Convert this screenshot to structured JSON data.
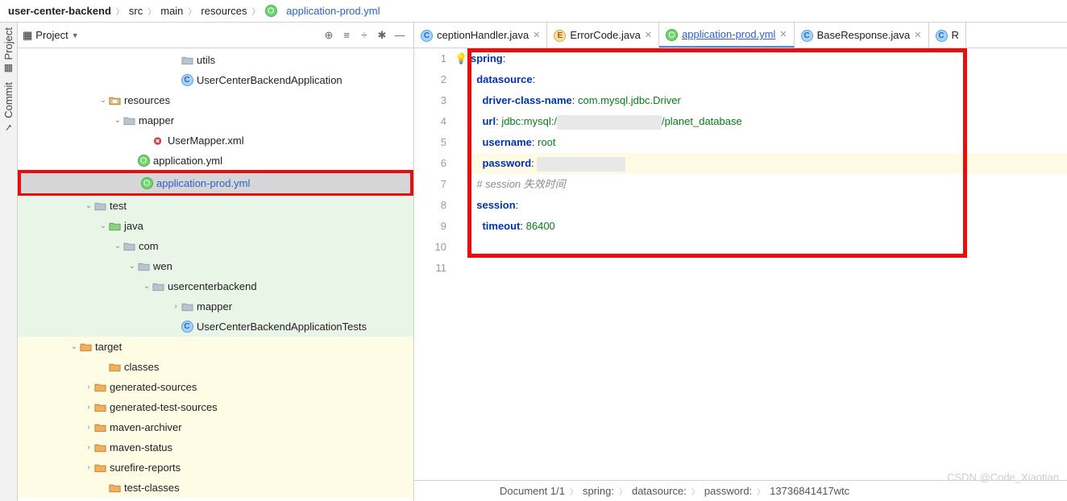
{
  "breadcrumbs": [
    "user-center-backend",
    "src",
    "main",
    "resources",
    "application-prod.yml"
  ],
  "sidebar": {
    "title": "Project",
    "tools": [
      "Project",
      "Commit"
    ],
    "tree": [
      {
        "indent": 190,
        "icon": "folder",
        "label": "utils"
      },
      {
        "indent": 190,
        "icon": "class",
        "label": "UserCenterBackendApplication"
      },
      {
        "indent": 100,
        "icon": "folder-res",
        "label": "resources",
        "arrow": "v"
      },
      {
        "indent": 118,
        "icon": "folder",
        "label": "mapper",
        "arrow": "v"
      },
      {
        "indent": 154,
        "icon": "xml",
        "label": "UserMapper.xml"
      },
      {
        "indent": 136,
        "icon": "yml",
        "label": "application.yml"
      },
      {
        "indent": 136,
        "icon": "yml",
        "label": "application-prod.yml",
        "sel": true,
        "hl": true,
        "link": true
      },
      {
        "indent": 82,
        "icon": "folder-test",
        "label": "test",
        "arrow": "v",
        "cls": "testbg"
      },
      {
        "indent": 100,
        "icon": "folder-src",
        "label": "java",
        "arrow": "v",
        "cls": "testbg"
      },
      {
        "indent": 118,
        "icon": "folder",
        "label": "com",
        "arrow": "v",
        "cls": "testbg"
      },
      {
        "indent": 136,
        "icon": "folder",
        "label": "wen",
        "arrow": "v",
        "cls": "testbg"
      },
      {
        "indent": 154,
        "icon": "folder",
        "label": "usercenterbackend",
        "arrow": "v",
        "cls": "testbg"
      },
      {
        "indent": 190,
        "icon": "folder",
        "label": "mapper",
        "arrow": ">",
        "cls": "testbg"
      },
      {
        "indent": 190,
        "icon": "class",
        "label": "UserCenterBackendApplicationTests",
        "cls": "testbg"
      },
      {
        "indent": 64,
        "icon": "folder-orange",
        "label": "target",
        "arrow": "v",
        "cls": "targbg"
      },
      {
        "indent": 100,
        "icon": "folder-orange",
        "label": "classes",
        "cls": "targbg"
      },
      {
        "indent": 82,
        "icon": "folder-orange",
        "label": "generated-sources",
        "arrow": ">",
        "cls": "targbg"
      },
      {
        "indent": 82,
        "icon": "folder-orange",
        "label": "generated-test-sources",
        "arrow": ">",
        "cls": "targbg"
      },
      {
        "indent": 82,
        "icon": "folder-orange",
        "label": "maven-archiver",
        "arrow": ">",
        "cls": "targbg"
      },
      {
        "indent": 82,
        "icon": "folder-orange",
        "label": "maven-status",
        "arrow": ">",
        "cls": "targbg"
      },
      {
        "indent": 82,
        "icon": "folder-orange",
        "label": "surefire-reports",
        "arrow": ">",
        "cls": "targbg"
      },
      {
        "indent": 100,
        "icon": "folder-orange",
        "label": "test-classes",
        "cls": "targbg"
      }
    ]
  },
  "tabs": [
    {
      "label": "ceptionHandler.java",
      "icon": "c",
      "active": false
    },
    {
      "label": "ErrorCode.java",
      "icon": "e",
      "active": false
    },
    {
      "label": "application-prod.yml",
      "icon": "yml",
      "active": true
    },
    {
      "label": "BaseResponse.java",
      "icon": "c",
      "active": false
    },
    {
      "label": "R",
      "icon": "c",
      "active": false,
      "cut": true
    }
  ],
  "code": {
    "lines": [
      {
        "n": 1,
        "html": "<span class='k'>spring</span>:"
      },
      {
        "n": 2,
        "html": "  <span class='k'>datasource</span>:"
      },
      {
        "n": 3,
        "html": "    <span class='k'>driver-class-name</span>: <span class='s'>com.mysql.jdbc.Driver</span>"
      },
      {
        "n": 4,
        "html": "    <span class='k'>url</span>: <span class='s'>jdbc:mysql:/</span><span class='mask'></span><span class='s'>/planet_database</span>"
      },
      {
        "n": 5,
        "html": "    <span class='k'>username</span>: <span class='s'>root</span>"
      },
      {
        "n": 6,
        "html": "    <span class='k'>password</span>: <span class='mask sm'></span>",
        "hl": true,
        "bulb": true
      },
      {
        "n": 7,
        "html": "  <span class='cmt'># session 失效时间</span>"
      },
      {
        "n": 8,
        "html": "  <span class='k'>session</span>:"
      },
      {
        "n": 9,
        "html": "    <span class='k'>timeout</span>: <span class='s'>86400</span>"
      },
      {
        "n": 10,
        "html": ""
      },
      {
        "n": 11,
        "html": ""
      }
    ]
  },
  "status": [
    "Document 1/1",
    "spring:",
    "datasource:",
    "password:",
    "13736841417wtc"
  ],
  "watermark": "CSDN @Code_Xiaotian"
}
